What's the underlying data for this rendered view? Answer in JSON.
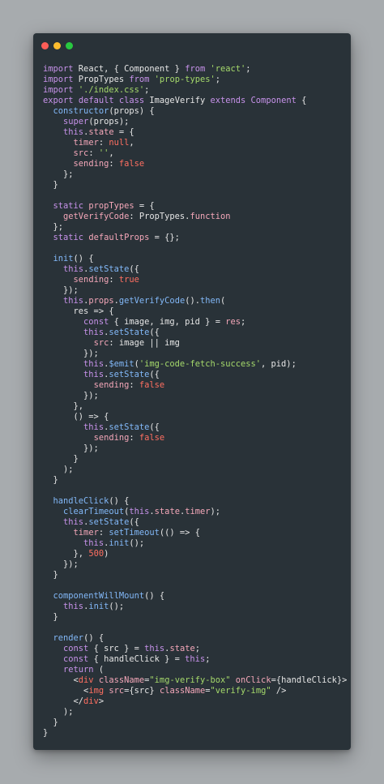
{
  "window": {
    "controls": [
      {
        "name": "close-dot",
        "color": "#fc5d57"
      },
      {
        "name": "minimize-dot",
        "color": "#fcbc2e"
      },
      {
        "name": "maximize-dot",
        "color": "#28c840"
      }
    ]
  },
  "colors": {
    "background": "#a7abae",
    "editor": "#293238",
    "keyword": "#c792ea",
    "string": "#a5d96b",
    "value": "#ff6f61",
    "property": "#f4a7b9",
    "function": "#82b8f8"
  },
  "code": {
    "lines": [
      [
        [
          "k",
          "import"
        ],
        [
          "t",
          " React, { Component } "
        ],
        [
          "k",
          "from"
        ],
        [
          "t",
          " "
        ],
        [
          "s",
          "'react'"
        ],
        [
          "t",
          ";"
        ]
      ],
      [
        [
          "k",
          "import"
        ],
        [
          "t",
          " PropTypes "
        ],
        [
          "k",
          "from"
        ],
        [
          "t",
          " "
        ],
        [
          "s",
          "'prop-types'"
        ],
        [
          "t",
          ";"
        ]
      ],
      [
        [
          "k",
          "import"
        ],
        [
          "t",
          " "
        ],
        [
          "s",
          "'./index.css'"
        ],
        [
          "t",
          ";"
        ]
      ],
      [
        [
          "k",
          "export"
        ],
        [
          "t",
          " "
        ],
        [
          "k",
          "default"
        ],
        [
          "t",
          " "
        ],
        [
          "k",
          "class"
        ],
        [
          "t",
          " ImageVerify "
        ],
        [
          "k",
          "extends"
        ],
        [
          "t",
          " "
        ],
        [
          "k",
          "Component"
        ],
        [
          "t",
          " {"
        ]
      ],
      [
        [
          "t",
          "  "
        ],
        [
          "f",
          "constructor"
        ],
        [
          "t",
          "(props) {"
        ]
      ],
      [
        [
          "t",
          "    "
        ],
        [
          "k",
          "super"
        ],
        [
          "t",
          "(props);"
        ]
      ],
      [
        [
          "t",
          "    "
        ],
        [
          "k",
          "this"
        ],
        [
          "t",
          "."
        ],
        [
          "p",
          "state"
        ],
        [
          "t",
          " = {"
        ]
      ],
      [
        [
          "t",
          "      "
        ],
        [
          "p",
          "timer"
        ],
        [
          "t",
          ": "
        ],
        [
          "v",
          "null"
        ],
        [
          "t",
          ","
        ]
      ],
      [
        [
          "t",
          "      "
        ],
        [
          "p",
          "src"
        ],
        [
          "t",
          ": "
        ],
        [
          "s",
          "''"
        ],
        [
          "t",
          ","
        ]
      ],
      [
        [
          "t",
          "      "
        ],
        [
          "p",
          "sending"
        ],
        [
          "t",
          ": "
        ],
        [
          "v",
          "false"
        ]
      ],
      [
        [
          "t",
          "    };"
        ]
      ],
      [
        [
          "t",
          "  }"
        ]
      ],
      [
        [
          "t",
          ""
        ]
      ],
      [
        [
          "t",
          "  "
        ],
        [
          "k",
          "static"
        ],
        [
          "t",
          " "
        ],
        [
          "p",
          "propTypes"
        ],
        [
          "t",
          " = {"
        ]
      ],
      [
        [
          "t",
          "    "
        ],
        [
          "p",
          "getVerifyCode"
        ],
        [
          "t",
          ": PropTypes."
        ],
        [
          "p",
          "function"
        ]
      ],
      [
        [
          "t",
          "  };"
        ]
      ],
      [
        [
          "t",
          "  "
        ],
        [
          "k",
          "static"
        ],
        [
          "t",
          " "
        ],
        [
          "p",
          "defaultProps"
        ],
        [
          "t",
          " = {};"
        ]
      ],
      [
        [
          "t",
          ""
        ]
      ],
      [
        [
          "t",
          "  "
        ],
        [
          "f",
          "init"
        ],
        [
          "t",
          "() {"
        ]
      ],
      [
        [
          "t",
          "    "
        ],
        [
          "k",
          "this"
        ],
        [
          "t",
          "."
        ],
        [
          "f",
          "setState"
        ],
        [
          "t",
          "({"
        ]
      ],
      [
        [
          "t",
          "      "
        ],
        [
          "p",
          "sending"
        ],
        [
          "t",
          ": "
        ],
        [
          "v",
          "true"
        ]
      ],
      [
        [
          "t",
          "    });"
        ]
      ],
      [
        [
          "t",
          "    "
        ],
        [
          "k",
          "this"
        ],
        [
          "t",
          "."
        ],
        [
          "p",
          "props"
        ],
        [
          "t",
          "."
        ],
        [
          "f",
          "getVerifyCode"
        ],
        [
          "t",
          "()."
        ],
        [
          "f",
          "then"
        ],
        [
          "t",
          "("
        ]
      ],
      [
        [
          "t",
          "      res => {"
        ]
      ],
      [
        [
          "t",
          "        "
        ],
        [
          "k",
          "const"
        ],
        [
          "t",
          " { image, img, pid } = "
        ],
        [
          "p",
          "res"
        ],
        [
          "t",
          ";"
        ]
      ],
      [
        [
          "t",
          "        "
        ],
        [
          "k",
          "this"
        ],
        [
          "t",
          "."
        ],
        [
          "f",
          "setState"
        ],
        [
          "t",
          "({"
        ]
      ],
      [
        [
          "t",
          "          "
        ],
        [
          "p",
          "src"
        ],
        [
          "t",
          ": image || img"
        ]
      ],
      [
        [
          "t",
          "        });"
        ]
      ],
      [
        [
          "t",
          "        "
        ],
        [
          "k",
          "this"
        ],
        [
          "t",
          "."
        ],
        [
          "f",
          "$emit"
        ],
        [
          "t",
          "("
        ],
        [
          "s",
          "'img-code-fetch-success'"
        ],
        [
          "t",
          ", pid);"
        ]
      ],
      [
        [
          "t",
          "        "
        ],
        [
          "k",
          "this"
        ],
        [
          "t",
          "."
        ],
        [
          "f",
          "setState"
        ],
        [
          "t",
          "({"
        ]
      ],
      [
        [
          "t",
          "          "
        ],
        [
          "p",
          "sending"
        ],
        [
          "t",
          ": "
        ],
        [
          "v",
          "false"
        ]
      ],
      [
        [
          "t",
          "        });"
        ]
      ],
      [
        [
          "t",
          "      },"
        ]
      ],
      [
        [
          "t",
          "      () => {"
        ]
      ],
      [
        [
          "t",
          "        "
        ],
        [
          "k",
          "this"
        ],
        [
          "t",
          "."
        ],
        [
          "f",
          "setState"
        ],
        [
          "t",
          "({"
        ]
      ],
      [
        [
          "t",
          "          "
        ],
        [
          "p",
          "sending"
        ],
        [
          "t",
          ": "
        ],
        [
          "v",
          "false"
        ]
      ],
      [
        [
          "t",
          "        });"
        ]
      ],
      [
        [
          "t",
          "      }"
        ]
      ],
      [
        [
          "t",
          "    );"
        ]
      ],
      [
        [
          "t",
          "  }"
        ]
      ],
      [
        [
          "t",
          ""
        ]
      ],
      [
        [
          "t",
          "  "
        ],
        [
          "f",
          "handleClick"
        ],
        [
          "t",
          "() {"
        ]
      ],
      [
        [
          "t",
          "    "
        ],
        [
          "f",
          "clearTimeout"
        ],
        [
          "t",
          "("
        ],
        [
          "k",
          "this"
        ],
        [
          "t",
          "."
        ],
        [
          "p",
          "state"
        ],
        [
          "t",
          "."
        ],
        [
          "p",
          "timer"
        ],
        [
          "t",
          ");"
        ]
      ],
      [
        [
          "t",
          "    "
        ],
        [
          "k",
          "this"
        ],
        [
          "t",
          "."
        ],
        [
          "f",
          "setState"
        ],
        [
          "t",
          "({"
        ]
      ],
      [
        [
          "t",
          "      "
        ],
        [
          "p",
          "timer"
        ],
        [
          "t",
          ": "
        ],
        [
          "f",
          "setTimeout"
        ],
        [
          "t",
          "(() => {"
        ]
      ],
      [
        [
          "t",
          "        "
        ],
        [
          "k",
          "this"
        ],
        [
          "t",
          "."
        ],
        [
          "f",
          "init"
        ],
        [
          "t",
          "();"
        ]
      ],
      [
        [
          "t",
          "      }, "
        ],
        [
          "v",
          "500"
        ],
        [
          "t",
          ")"
        ]
      ],
      [
        [
          "t",
          "    });"
        ]
      ],
      [
        [
          "t",
          "  }"
        ]
      ],
      [
        [
          "t",
          ""
        ]
      ],
      [
        [
          "t",
          "  "
        ],
        [
          "f",
          "componentWillMount"
        ],
        [
          "t",
          "() {"
        ]
      ],
      [
        [
          "t",
          "    "
        ],
        [
          "k",
          "this"
        ],
        [
          "t",
          "."
        ],
        [
          "f",
          "init"
        ],
        [
          "t",
          "();"
        ]
      ],
      [
        [
          "t",
          "  }"
        ]
      ],
      [
        [
          "t",
          ""
        ]
      ],
      [
        [
          "t",
          "  "
        ],
        [
          "f",
          "render"
        ],
        [
          "t",
          "() {"
        ]
      ],
      [
        [
          "t",
          "    "
        ],
        [
          "k",
          "const"
        ],
        [
          "t",
          " { src } = "
        ],
        [
          "k",
          "this"
        ],
        [
          "t",
          "."
        ],
        [
          "p",
          "state"
        ],
        [
          "t",
          ";"
        ]
      ],
      [
        [
          "t",
          "    "
        ],
        [
          "k",
          "const"
        ],
        [
          "t",
          " { handleClick } = "
        ],
        [
          "k",
          "this"
        ],
        [
          "t",
          ";"
        ]
      ],
      [
        [
          "t",
          "    "
        ],
        [
          "k",
          "return"
        ],
        [
          "t",
          " ("
        ]
      ],
      [
        [
          "t",
          "      <"
        ],
        [
          "v",
          "div"
        ],
        [
          "t",
          " "
        ],
        [
          "p",
          "className"
        ],
        [
          "t",
          "="
        ],
        [
          "s",
          "\"img-verify-box\""
        ],
        [
          "t",
          " "
        ],
        [
          "p",
          "onClick"
        ],
        [
          "t",
          "={handleClick}>"
        ]
      ],
      [
        [
          "t",
          "        <"
        ],
        [
          "v",
          "img"
        ],
        [
          "t",
          " "
        ],
        [
          "p",
          "src"
        ],
        [
          "t",
          "={src} "
        ],
        [
          "p",
          "className"
        ],
        [
          "t",
          "="
        ],
        [
          "s",
          "\"verify-img\""
        ],
        [
          "t",
          " />"
        ]
      ],
      [
        [
          "t",
          "      </"
        ],
        [
          "v",
          "div"
        ],
        [
          "t",
          ">"
        ]
      ],
      [
        [
          "t",
          "    );"
        ]
      ],
      [
        [
          "t",
          "  }"
        ]
      ],
      [
        [
          "t",
          "}"
        ]
      ]
    ]
  }
}
